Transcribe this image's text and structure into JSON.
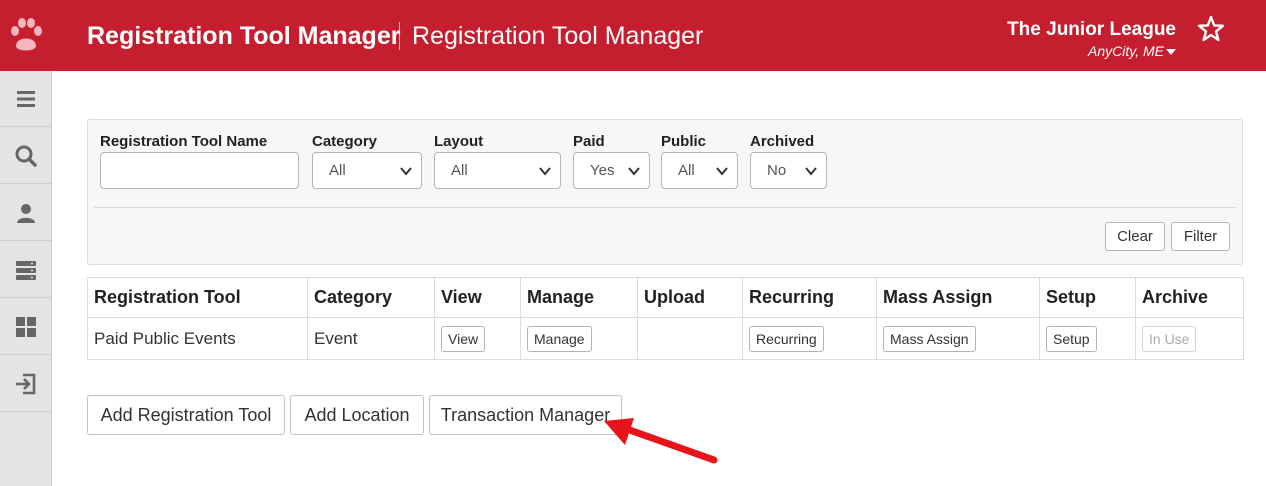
{
  "header": {
    "title": "Registration Tool Manager",
    "subtitle": "Registration Tool Manager",
    "org_name": "The Junior League",
    "org_city": "AnyCity, ME",
    "logo_icon": "paw-icon",
    "favorite_icon": "star-icon",
    "brand_color": "#c41e2f"
  },
  "sidebar": {
    "items": [
      {
        "name": "menu",
        "icon": "hamburger-icon"
      },
      {
        "name": "search",
        "icon": "search-icon"
      },
      {
        "name": "profile",
        "icon": "user-icon"
      },
      {
        "name": "server",
        "icon": "server-icon"
      },
      {
        "name": "dashboard",
        "icon": "grid-icon"
      },
      {
        "name": "logout",
        "icon": "logout-icon"
      }
    ]
  },
  "filters": {
    "name_label": "Registration Tool Name",
    "name_value": "",
    "category_label": "Category",
    "category_value": "All",
    "layout_label": "Layout",
    "layout_value": "All",
    "paid_label": "Paid",
    "paid_value": "Yes",
    "public_label": "Public",
    "public_value": "All",
    "archived_label": "Archived",
    "archived_value": "No",
    "clear_label": "Clear",
    "filter_label": "Filter"
  },
  "table": {
    "headers": [
      "Registration Tool",
      "Category",
      "View",
      "Manage",
      "Upload",
      "Recurring",
      "Mass Assign",
      "Setup",
      "Archive"
    ],
    "rows": [
      {
        "tool": "Paid Public Events",
        "category": "Event",
        "view": "View",
        "manage": "Manage",
        "upload": "",
        "recurring": "Recurring",
        "mass_assign": "Mass Assign",
        "setup": "Setup",
        "archive": "In Use"
      }
    ]
  },
  "actions": {
    "add_tool": "Add Registration Tool",
    "add_location": "Add Location",
    "transaction_manager": "Transaction Manager"
  },
  "annotation": {
    "arrow_color": "#e8141b"
  }
}
